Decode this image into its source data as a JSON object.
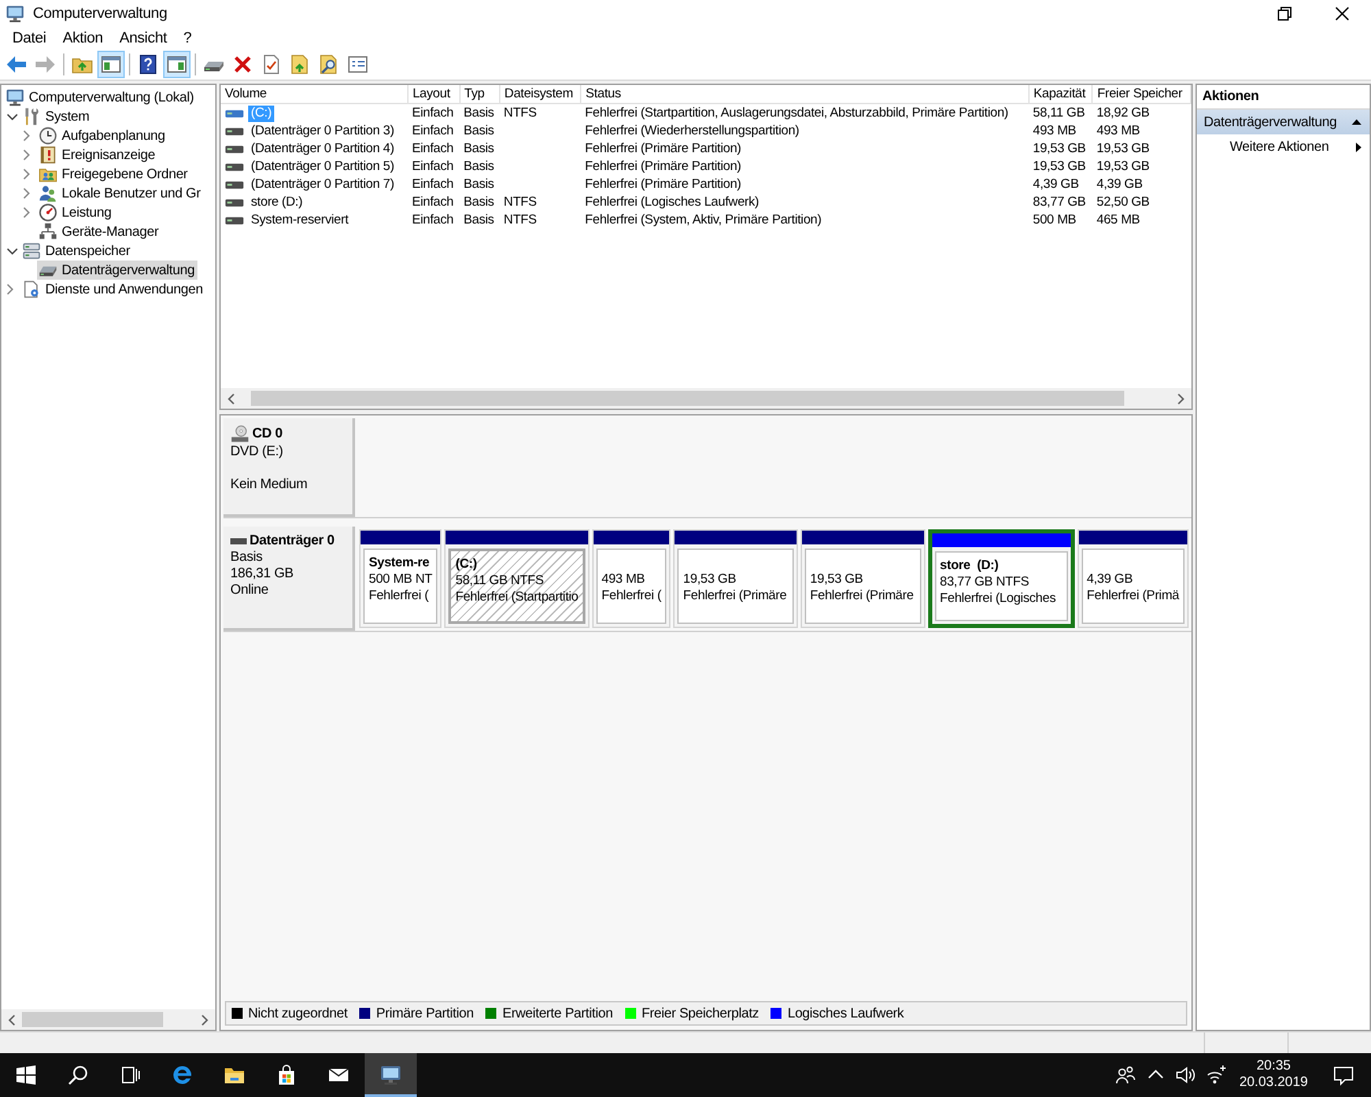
{
  "window": {
    "title": "Computerverwaltung"
  },
  "menu": [
    {
      "label": "Datei"
    },
    {
      "label": "Aktion"
    },
    {
      "label": "Ansicht"
    },
    {
      "label": "?"
    }
  ],
  "toolbar": {
    "groups": [
      {
        "buttons": [
          {
            "on": false,
            "disabled": false
          },
          {
            "on": false,
            "disabled": true
          }
        ]
      },
      {
        "buttons": [
          {
            "on": false,
            "disabled": false
          },
          {
            "on": true,
            "disabled": false
          }
        ]
      },
      {
        "buttons": [
          {
            "on": false,
            "disabled": false
          },
          {
            "on": true,
            "disabled": false
          }
        ]
      },
      {
        "buttons": [
          {
            "on": false,
            "disabled": false
          },
          {
            "on": false,
            "disabled": false
          },
          {
            "on": false,
            "disabled": false
          },
          {
            "on": false,
            "disabled": false
          },
          {
            "on": false,
            "disabled": false
          },
          {
            "on": false,
            "disabled": false
          }
        ]
      }
    ]
  },
  "tree": {
    "items": [
      {
        "label": "Computerverwaltung (Lokal)",
        "kind": "root",
        "selected": false,
        "children": [
          {
            "label": "System",
            "kind": "branch",
            "expanded": true,
            "selected": false,
            "children": [
              {
                "label": "Aufgabenplanung",
                "kind": "branch",
                "expanded": false,
                "selected": false
              },
              {
                "label": "Ereignisanzeige",
                "kind": "branch",
                "expanded": false,
                "selected": false
              },
              {
                "label": "Freigegebene Ordner",
                "kind": "branch",
                "expanded": false,
                "selected": false
              },
              {
                "label": "Lokale Benutzer und Gr",
                "kind": "branch",
                "expanded": false,
                "selected": false
              },
              {
                "label": "Leistung",
                "kind": "branch",
                "expanded": false,
                "selected": false
              },
              {
                "label": "Geräte-Manager",
                "kind": "leaf",
                "selected": false
              }
            ]
          },
          {
            "label": "Datenspeicher",
            "kind": "branch",
            "expanded": true,
            "selected": false,
            "children": [
              {
                "label": "Datenträgerverwaltung",
                "kind": "leaf",
                "selected": true
              }
            ]
          },
          {
            "label": "Dienste und Anwendungen",
            "kind": "branch",
            "expanded": false,
            "selected": false
          }
        ]
      }
    ]
  },
  "volume_table": {
    "columns": [
      "Volume",
      "Layout",
      "Typ",
      "Dateisystem",
      "Status",
      "Kapazität",
      "Freier Speicher"
    ],
    "rows": [
      {
        "volume": "(C:)",
        "layout": "Einfach",
        "type": "Basis",
        "file_system": "NTFS",
        "status": "Fehlerfrei (Startpartition, Auslagerungsdatei, Absturzabbild, Primäre Partition)",
        "capacity": "58,11 GB",
        "free_space": "18,92 GB",
        "selected": true
      },
      {
        "volume": "(Datenträger 0 Partition 3)",
        "layout": "Einfach",
        "type": "Basis",
        "status": "Fehlerfrei (Wiederherstellungspartition)",
        "capacity": "493 MB",
        "free_space": "493 MB",
        "selected": false
      },
      {
        "volume": "(Datenträger 0 Partition 4)",
        "layout": "Einfach",
        "type": "Basis",
        "status": "Fehlerfrei (Primäre Partition)",
        "capacity": "19,53 GB",
        "free_space": "19,53 GB",
        "selected": false
      },
      {
        "volume": "(Datenträger 0 Partition 5)",
        "layout": "Einfach",
        "type": "Basis",
        "status": "Fehlerfrei (Primäre Partition)",
        "capacity": "19,53 GB",
        "free_space": "19,53 GB",
        "selected": false
      },
      {
        "volume": "(Datenträger 0 Partition 7)",
        "layout": "Einfach",
        "type": "Basis",
        "status": "Fehlerfrei (Primäre Partition)",
        "capacity": "4,39 GB",
        "free_space": "4,39 GB",
        "selected": false
      },
      {
        "volume": "store (D:)",
        "layout": "Einfach",
        "type": "Basis",
        "file_system": "NTFS",
        "status": "Fehlerfrei (Logisches Laufwerk)",
        "capacity": "83,77 GB",
        "free_space": "52,50 GB",
        "selected": false
      },
      {
        "volume": "System-reserviert",
        "layout": "Einfach",
        "type": "Basis",
        "file_system": "NTFS",
        "status": "Fehlerfrei (System, Aktiv, Primäre Partition)",
        "capacity": "500 MB",
        "free_space": "465 MB",
        "selected": false
      }
    ]
  },
  "disk_area": {
    "disks": [
      {
        "kind": "cd",
        "name": "CD 0",
        "details": [
          "DVD (E:)"
        ],
        "status": "Kein Medium"
      },
      {
        "kind": "basic",
        "name": "Datenträger 0",
        "details": [
          "Basis",
          "186,31 GB"
        ],
        "status": "Online",
        "partitions": [
          {
            "kind": "primary",
            "name": "System-re",
            "size": "500 MB NT",
            "status": "Fehlerfrei (",
            "selected": false
          },
          {
            "kind": "primary",
            "name": "(C:)",
            "size": "58,11 GB NTFS",
            "status": "Fehlerfrei (Startpartitio",
            "selected": true
          },
          {
            "kind": "primary",
            "size": "493 MB",
            "status": "Fehlerfrei (",
            "selected": false
          },
          {
            "kind": "primary",
            "size": "19,53 GB",
            "status": "Fehlerfrei (Primäre",
            "selected": false
          },
          {
            "kind": "primary",
            "size": "19,53 GB",
            "status": "Fehlerfrei (Primäre",
            "selected": false
          },
          {
            "kind": "logical",
            "name": "store  (D:)",
            "size": "83,77 GB NTFS",
            "status": "Fehlerfrei (Logisches",
            "selected": false
          },
          {
            "kind": "primary",
            "size": "4,39 GB",
            "status": "Fehlerfrei (Primä",
            "selected": false
          }
        ]
      }
    ]
  },
  "legend": [
    {
      "label": "Nicht zugeordnet",
      "color": "#000000"
    },
    {
      "label": "Primäre Partition",
      "color": "#000080"
    },
    {
      "label": "Erweiterte Partition",
      "color": "#008000"
    },
    {
      "label": "Freier Speicherplatz",
      "color": "#00ff00"
    },
    {
      "label": "Logisches Laufwerk",
      "color": "#0000ff"
    }
  ],
  "actions": {
    "title": "Aktionen",
    "sections": [
      {
        "label": "Datenträgerverwaltung",
        "expanded": true,
        "items": [
          {
            "label": "Weitere Aktionen",
            "submenu": true
          }
        ]
      }
    ]
  },
  "taskbar": {
    "pinned": [
      {
        "selected": false
      },
      {
        "selected": false
      },
      {
        "selected": false
      },
      {
        "selected": false
      },
      {
        "selected": true
      }
    ],
    "clock": {
      "time": "20:35",
      "date": "20.03.2019"
    }
  }
}
